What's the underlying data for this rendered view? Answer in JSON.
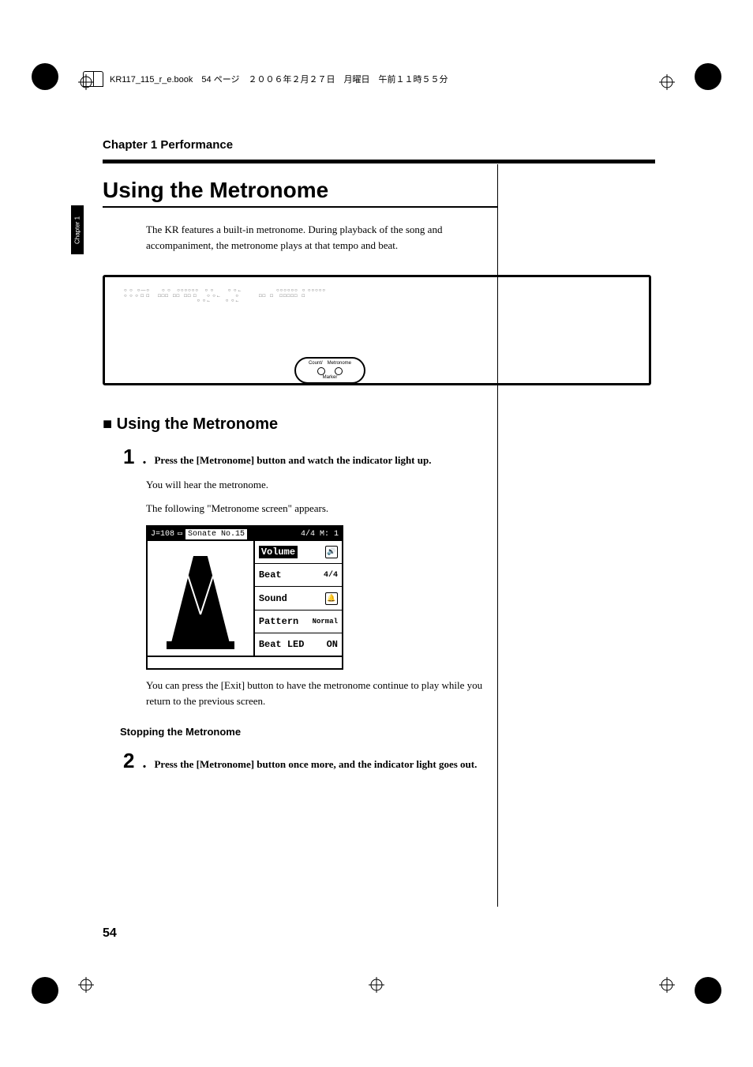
{
  "header_line": "KR117_115_r_e.book　54 ページ　２００６年２月２７日　月曜日　午前１１時５５分",
  "chapter_tab": "Chapter 1",
  "chapter_title": "Chapter 1 Performance",
  "main_heading": "Using the Metronome",
  "intro_para": "The KR features a built-in metronome. During playback of the song and accompaniment, the metronome plays at that tempo and beat.",
  "diag_callout_labels": {
    "left": "Count/",
    "right": "Metronome",
    "bottom": "Marker"
  },
  "sub_heading": "Using the Metronome",
  "steps": {
    "s1": {
      "num": "1",
      "text": "Press the [Metronome] button and watch the indicator light up."
    },
    "s2": {
      "num": "2",
      "text": "Press the [Metronome] button once more, and the indicator light goes out."
    }
  },
  "body": {
    "after_step1_a": "You will hear the metronome.",
    "after_step1_b": "The following \"Metronome screen\" appears.",
    "after_screen": "You can press the [Exit] button to have the metronome continue to play while you return to the previous screen."
  },
  "subsection_title": "Stopping the Metronome",
  "metronome_screen": {
    "title_left": "J=108",
    "title_song": "Sonate No.15",
    "title_right_time": "4/4",
    "title_right_m": "M:",
    "title_right_num": "1",
    "rows": {
      "volume": {
        "label": "Volume",
        "value_icon": "speaker"
      },
      "beat": {
        "label": "Beat",
        "value": "4/4"
      },
      "sound": {
        "label": "Sound",
        "value_icon": "bell"
      },
      "pattern": {
        "label": "Pattern",
        "value": "Normal"
      },
      "beat_led": {
        "label": "Beat LED",
        "value": "ON"
      }
    }
  },
  "page_number": "54"
}
